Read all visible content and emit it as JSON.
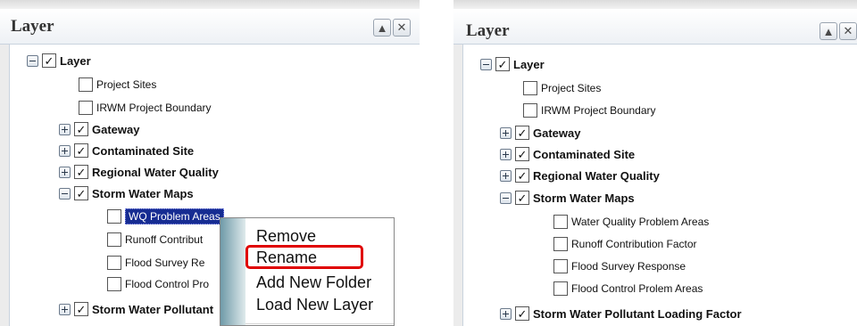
{
  "left_panel": {
    "title": "Layer",
    "root_label": "Layer",
    "project_sites": "Project Sites",
    "irwm": "IRWM Project Boundary",
    "gateway": "Gateway",
    "contaminated": "Contaminated Site",
    "regional": "Regional Water Quality",
    "storm": "Storm Water Maps",
    "wq_problem": "WQ Problem Areas",
    "runoff": "Runoff Contribut",
    "flood_survey": "Flood Survey Re",
    "flood_control": "Flood Control Pro",
    "pollutant": "Storm Water Pollutant",
    "context_menu": {
      "remove": "Remove",
      "rename": "Rename",
      "add_folder": "Add New Folder",
      "load_layer": "Load New Layer"
    }
  },
  "right_panel": {
    "title": "Layer",
    "root_label": "Layer",
    "project_sites": "Project Sites",
    "irwm": "IRWM Project Boundary",
    "gateway": "Gateway",
    "contaminated": "Contaminated Site",
    "regional": "Regional Water Quality",
    "storm": "Storm Water Maps",
    "wq_problem": "Water Quality Problem Areas",
    "runoff": "Runoff Contribution Factor",
    "flood_survey": "Flood Survey Response",
    "flood_control": "Flood Control Prolem Areas",
    "pollutant": "Storm Water Pollutant Loading Factor"
  },
  "icons": {
    "collapse": "up-arrow-icon",
    "close": "close-icon",
    "checked": "✓"
  },
  "colors": {
    "selection": "#162c92",
    "highlight_box": "#e00000"
  }
}
